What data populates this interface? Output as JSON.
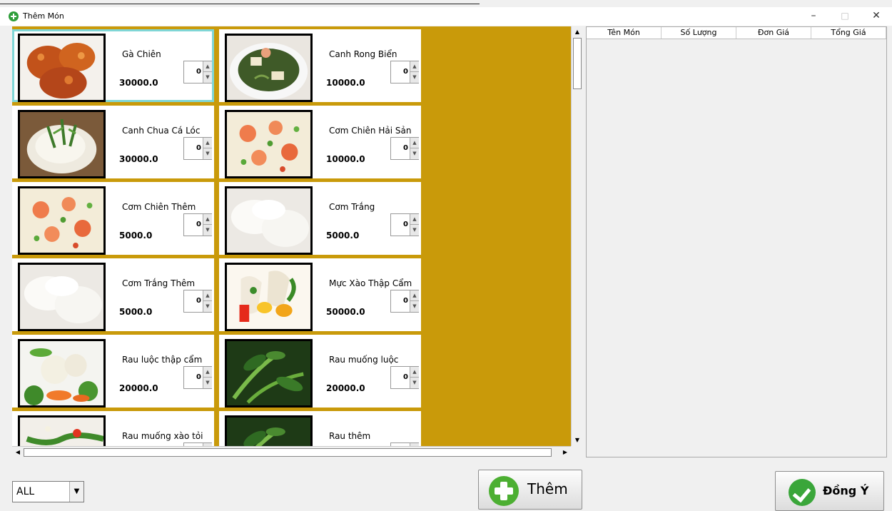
{
  "window": {
    "title": "Thêm Món",
    "icon": "add-circle-icon",
    "controls": {
      "minimize": "–",
      "maximize": "□",
      "close": "✕"
    }
  },
  "menu_items": [
    {
      "name": "Gà Chiên",
      "price": "30000.0",
      "qty": "0",
      "image": "fried-chicken",
      "selected": true
    },
    {
      "name": "Canh Rong Biển",
      "price": "10000.0",
      "qty": "0",
      "image": "seaweed-soup"
    },
    {
      "name": "Canh Chua Cá Lóc",
      "price": "30000.0",
      "qty": "0",
      "image": "sour-fish-soup"
    },
    {
      "name": "Cơm Chiên Hải Sản",
      "price": "10000.0",
      "qty": "0",
      "image": "seafood-fried-rice"
    },
    {
      "name": "Cơm Chiên Thêm",
      "price": "5000.0",
      "qty": "0",
      "image": "seafood-fried-rice"
    },
    {
      "name": "Cơm Trắng",
      "price": "5000.0",
      "qty": "0",
      "image": "white-rice"
    },
    {
      "name": "Cơm Trắng Thêm",
      "price": "5000.0",
      "qty": "0",
      "image": "white-rice"
    },
    {
      "name": "Mực Xào Thập Cẩm",
      "price": "50000.0",
      "qty": "0",
      "image": "stir-fried-squid"
    },
    {
      "name": "Rau luộc thập cẩm",
      "price": "20000.0",
      "qty": "0",
      "image": "boiled-vegetables"
    },
    {
      "name": "Rau muống luộc",
      "price": "20000.0",
      "qty": "0",
      "image": "water-spinach"
    },
    {
      "name": "Rau muống xào tỏi",
      "price": "",
      "qty": "",
      "image": "stir-fried-greens"
    },
    {
      "name": "Rau thêm",
      "price": "",
      "qty": "",
      "image": "water-spinach"
    }
  ],
  "order_table": {
    "columns": [
      "Tên Món",
      "Số Lượng",
      "Đơn Giá",
      "Tổng Giá"
    ],
    "rows": []
  },
  "filter": {
    "selected": "ALL"
  },
  "buttons": {
    "add": "Thêm",
    "confirm": "Đồng Ý"
  },
  "colors": {
    "panel_bg": "#c99a0a",
    "selected_outline": "#7fd6d6",
    "add_icon": "#4caf32",
    "confirm_icon": "#3aa63a"
  }
}
